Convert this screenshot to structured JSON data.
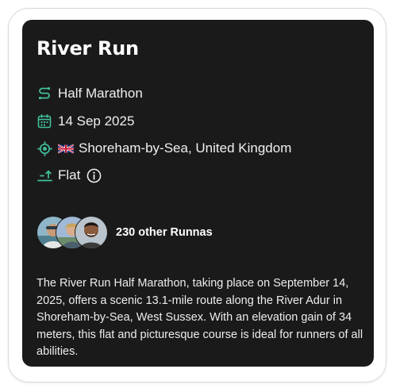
{
  "event": {
    "title": "River Run",
    "distance": "Half Marathon",
    "date": "14 Sep 2025",
    "location": "Shoreham-by-Sea, United Kingdom",
    "terrain": "Flat"
  },
  "runners": {
    "label": "230 other Runnas"
  },
  "description": "The River Run Half Marathon, taking place on September 14, 2025, offers a scenic 13.1-mile route along the River Adur in Shoreham-by-Sea, West Sussex. With an elevation gain of 34 meters, this flat and picturesque course is ideal for runners of all abilities.",
  "colors": {
    "accent": "#3fbf9a",
    "card_background": "#1b1a1b",
    "page_background": "#ffffff"
  },
  "icons": {
    "distance": "route-icon",
    "date": "calendar-icon",
    "location": "location-target-icon",
    "country_flag": "uk-flag-icon",
    "terrain": "elevation-icon",
    "info": "info-icon"
  }
}
